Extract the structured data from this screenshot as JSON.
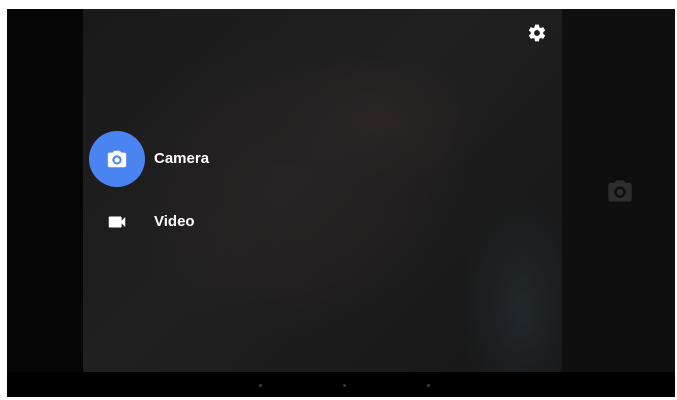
{
  "modes": [
    {
      "label": "Camera",
      "icon": "camera-icon",
      "active": true
    },
    {
      "label": "Video",
      "icon": "videocam-icon",
      "active": false
    }
  ],
  "toolbar": {
    "settings_icon": "gear-icon"
  },
  "side_panel": {
    "shutter_icon": "camera-icon"
  },
  "colors": {
    "accent": "#4a84f0",
    "background": "#050505",
    "text": "#ffffff"
  }
}
